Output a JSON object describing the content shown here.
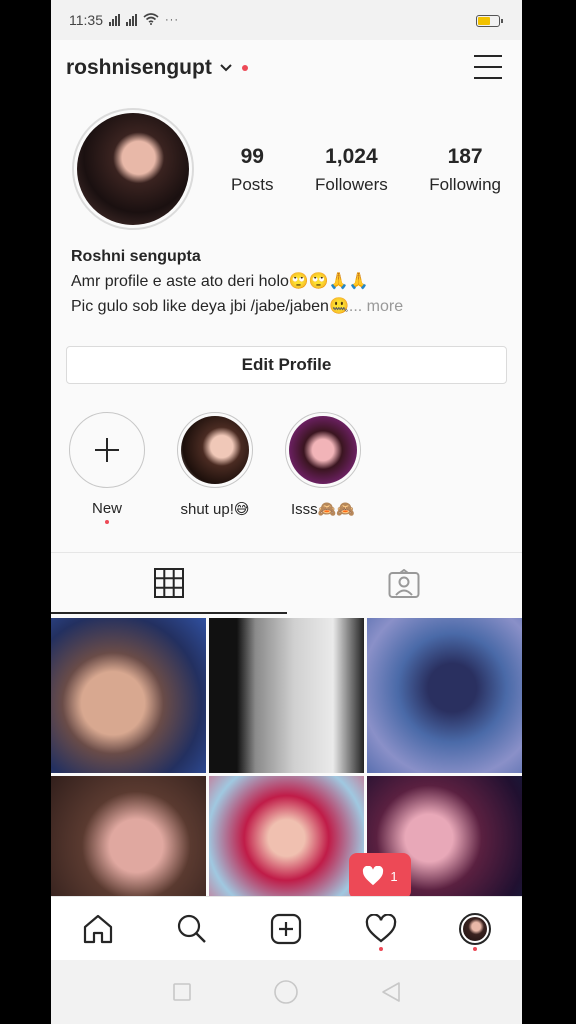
{
  "status_bar": {
    "time": "11:35",
    "extra": "···"
  },
  "header": {
    "username": "roshnisengupt"
  },
  "profile": {
    "stats": [
      {
        "value": "99",
        "label": "Posts"
      },
      {
        "value": "1,024",
        "label": "Followers"
      },
      {
        "value": "187",
        "label": "Following"
      }
    ],
    "name": "Roshni sengupta",
    "bio_line1": "Amr profile e aste ato deri holo🙄🙄🙏🙏",
    "bio_line2": "Pic gulo sob like deya jbi /jabe/jaben🤐",
    "more": "... more",
    "edit_button": "Edit Profile"
  },
  "highlights": [
    {
      "label": "New"
    },
    {
      "label": "shut up!😅"
    },
    {
      "label": "Isss🙈🙈"
    }
  ],
  "notifications": {
    "like_count": "1"
  },
  "colors": {
    "accent": "#ed4956",
    "text": "#262626",
    "border": "#dbdbdb"
  }
}
